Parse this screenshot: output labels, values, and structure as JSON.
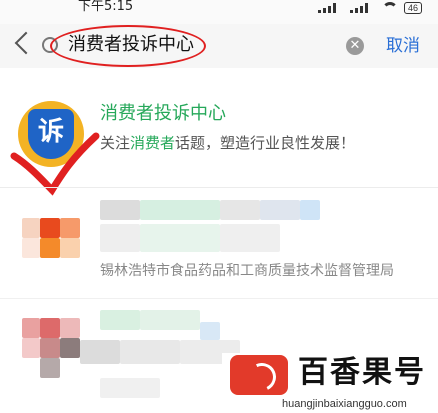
{
  "status_bar": {
    "time": "下午5:15",
    "battery": "46"
  },
  "search": {
    "query": "消费者投诉中心",
    "cancel_label": "取消"
  },
  "results": [
    {
      "title": "消费者投诉中心",
      "subtitle_parts": [
        "关注",
        "消费者",
        "话题，塑造行业良性发展！"
      ]
    },
    {
      "description": "锡林浩特市食品药品和工商质量技术监督管理局"
    }
  ],
  "watermark": {
    "brand": "百香果号",
    "url": "huangjinbaixiangguo.com"
  },
  "colors": {
    "accent_green": "#26a85a",
    "link_blue": "#2a6fd6",
    "annotation_red": "#e02020"
  }
}
